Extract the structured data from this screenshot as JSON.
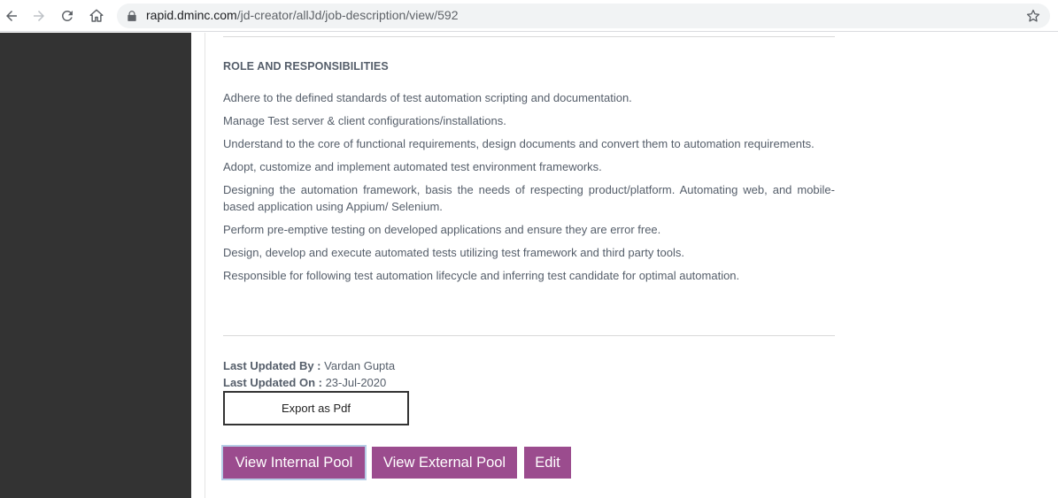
{
  "browser": {
    "url_host": "rapid.dminc.com",
    "url_path": "/jd-creator/allJd/job-description/view/592",
    "icons": [
      "back-arrow-icon",
      "forward-arrow-icon",
      "reload-icon",
      "home-icon",
      "lock-icon",
      "star-icon"
    ]
  },
  "section": {
    "title": "ROLE AND RESPONSIBILITIES",
    "items": [
      "Adhere to the defined standards of test automation scripting and documentation.",
      "Manage Test server & client configurations/installations.",
      "Understand to the core of functional requirements, design documents and convert them to automation requirements.",
      "Adopt, customize and implement automated test environment frameworks.",
      "Designing the automation framework, basis the needs of respecting product/platform. Automating web, and mobile-based application using Appium/ Selenium.",
      "Perform pre-emptive testing on developed applications and ensure they are error free.",
      "Design, develop and execute automated tests utilizing test framework and third party tools.",
      "Responsible for following test automation lifecycle and inferring test candidate for optimal automation."
    ]
  },
  "meta": {
    "updated_by_label": "Last Updated By :",
    "updated_by_value": "Vardan Gupta",
    "updated_on_label": "Last Updated On :",
    "updated_on_value": "23-Jul-2020"
  },
  "buttons": {
    "export": "Export as Pdf",
    "internal_pool": "View Internal Pool",
    "external_pool": "View External Pool",
    "edit": "Edit"
  },
  "colors": {
    "sidebar": "#333333",
    "action_button": "#9b4c8e",
    "text": "#555e6a"
  }
}
